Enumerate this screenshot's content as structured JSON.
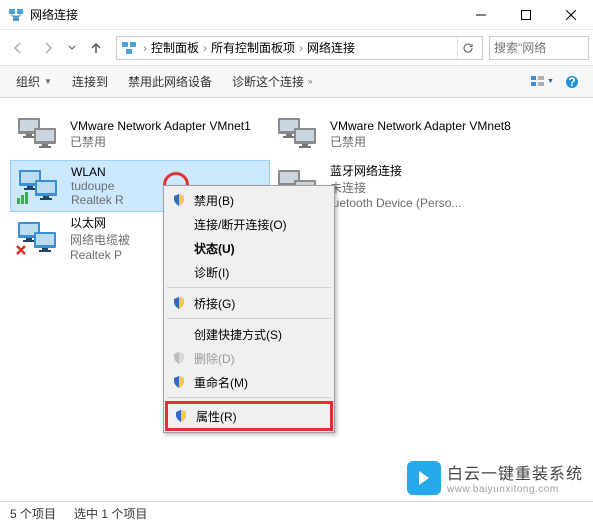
{
  "window": {
    "title": "网络连接"
  },
  "nav": {
    "breadcrumbs": [
      "控制面板",
      "所有控制面板项",
      "网络连接"
    ],
    "search_placeholder": "搜索\"网络"
  },
  "toolbar": {
    "organize": "组织",
    "connect_to": "连接到",
    "disable_device": "禁用此网络设备",
    "diagnose": "诊断这个连接"
  },
  "items": [
    {
      "name": "VMware Network Adapter VMnet1",
      "line2": "已禁用",
      "line3": "",
      "disabled": true
    },
    {
      "name": "VMware Network Adapter VMnet8",
      "line2": "已禁用",
      "line3": "",
      "disabled": true
    },
    {
      "name": "WLAN",
      "line2": "tudoupe",
      "line3": "Realtek R",
      "disabled": false,
      "selected": true
    },
    {
      "name": "蓝牙网络连接",
      "line2": "未连接",
      "line3": "luetooth Device (Perso...",
      "disabled": true
    },
    {
      "name": "以太网",
      "line2": "网络电缆被",
      "line3": "Realtek P",
      "disabled": false,
      "error": true
    }
  ],
  "context_menu": {
    "disable": "禁用(B)",
    "connect_disconnect": "连接/断开连接(O)",
    "status": "状态(U)",
    "diagnose": "诊断(I)",
    "bridge": "桥接(G)",
    "shortcut": "创建快捷方式(S)",
    "delete": "删除(D)",
    "rename": "重命名(M)",
    "properties": "属性(R)"
  },
  "status": {
    "count": "5 个项目",
    "selected": "选中 1 个项目"
  },
  "watermark": {
    "line1": "白云一键重装系统",
    "line2": "www.baiyunxitong.com"
  }
}
